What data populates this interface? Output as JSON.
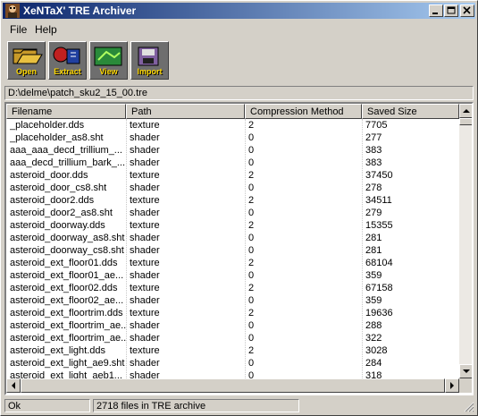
{
  "window": {
    "title": "XeNTaX' TRE Archiver"
  },
  "menu": {
    "items": [
      "File",
      "Help"
    ]
  },
  "toolbar": {
    "buttons": [
      {
        "label": "Open",
        "icon": "folder-open-icon",
        "color": "#ffd800"
      },
      {
        "label": "Extract",
        "icon": "extract-icon",
        "color": "#ffd800"
      },
      {
        "label": "View",
        "icon": "view-icon",
        "color": "#ffd800"
      },
      {
        "label": "Import",
        "icon": "import-icon",
        "color": "#ffd800"
      }
    ]
  },
  "path": {
    "value": "D:\\delme\\patch_sku2_15_00.tre"
  },
  "list": {
    "columns": [
      "Filename",
      "Path",
      "Compression Method",
      "Saved Size"
    ],
    "rows": [
      [
        "_placeholder.dds",
        "texture",
        "2",
        "7705"
      ],
      [
        "_placeholder_as8.sht",
        "shader",
        "0",
        "277"
      ],
      [
        "aaa_aaa_decd_trillium_...",
        "shader",
        "0",
        "383"
      ],
      [
        "aaa_decd_trillium_bark_...",
        "shader",
        "0",
        "383"
      ],
      [
        "asteroid_door.dds",
        "texture",
        "2",
        "37450"
      ],
      [
        "asteroid_door_cs8.sht",
        "shader",
        "0",
        "278"
      ],
      [
        "asteroid_door2.dds",
        "texture",
        "2",
        "34511"
      ],
      [
        "asteroid_door2_as8.sht",
        "shader",
        "0",
        "279"
      ],
      [
        "asteroid_doorway.dds",
        "texture",
        "2",
        "15355"
      ],
      [
        "asteroid_doorway_as8.sht",
        "shader",
        "0",
        "281"
      ],
      [
        "asteroid_doorway_cs8.sht",
        "shader",
        "0",
        "281"
      ],
      [
        "asteroid_ext_floor01.dds",
        "texture",
        "2",
        "68104"
      ],
      [
        "asteroid_ext_floor01_ae...",
        "shader",
        "0",
        "359"
      ],
      [
        "asteroid_ext_floor02.dds",
        "texture",
        "2",
        "67158"
      ],
      [
        "asteroid_ext_floor02_ae...",
        "shader",
        "0",
        "359"
      ],
      [
        "asteroid_ext_floortrim.dds",
        "texture",
        "2",
        "19636"
      ],
      [
        "asteroid_ext_floortrim_ae...",
        "shader",
        "0",
        "288"
      ],
      [
        "asteroid_ext_floortrim_ae...",
        "shader",
        "0",
        "322"
      ],
      [
        "asteroid_ext_light.dds",
        "texture",
        "2",
        "3028"
      ],
      [
        "asteroid_ext_light_ae9.sht",
        "shader",
        "0",
        "284"
      ],
      [
        "asteroid_ext_light_aeb1...",
        "shader",
        "0",
        "318"
      ]
    ]
  },
  "status": {
    "left": "Ok",
    "info": "2718 files in TRE archive"
  }
}
